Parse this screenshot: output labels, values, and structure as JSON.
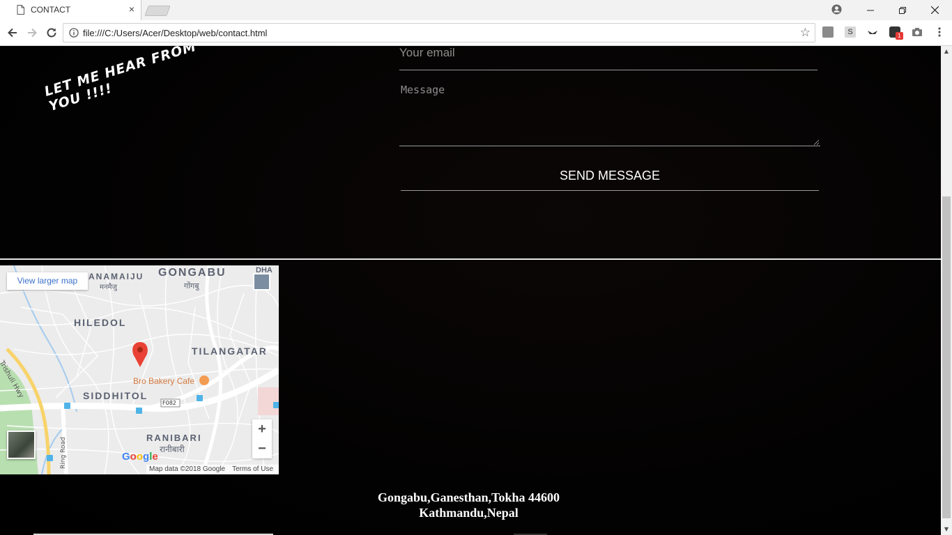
{
  "browser": {
    "tab_title": "CONTACT",
    "tab_close": "×",
    "url": "file:///C:/Users/Acer/Desktop/web/contact.html",
    "window_controls": {
      "minimize": "—",
      "restore": "❐",
      "close": "✕"
    },
    "extension_badge": "1"
  },
  "page": {
    "tagline": "LET ME HEAR FROM YOU !!!!",
    "email_placeholder": "Your email",
    "message_placeholder": "Message",
    "send_label": "SEND MESSAGE"
  },
  "map": {
    "view_larger": "View larger map",
    "labels": {
      "gongabu": "GONGABU",
      "gongabu_np": "गोंगबु",
      "anamaiju": "ANAMAIJU",
      "anamaiju_np": "मनमैजु",
      "dha": "DHA",
      "hiledol": "HILEDOL",
      "tilangatar": "TILANGATAR",
      "siddhitol": "SIDDHITOL",
      "ranibari": "RANIBARI",
      "ranibari_np": "रानीबारी",
      "cafe": "Bro Bakery Cafe",
      "trishuli": "Trishuli Hwy",
      "ring_road": "Ring Road",
      "f082": "F082"
    },
    "zoom_in": "+",
    "zoom_out": "−",
    "google": "Google",
    "attribution": "Map data ©2018 Google",
    "terms": "Terms of Use"
  },
  "address": {
    "line1": "Gongabu,Ganesthan,Tokha 44600",
    "line2": "Kathmandu,Nepal"
  }
}
